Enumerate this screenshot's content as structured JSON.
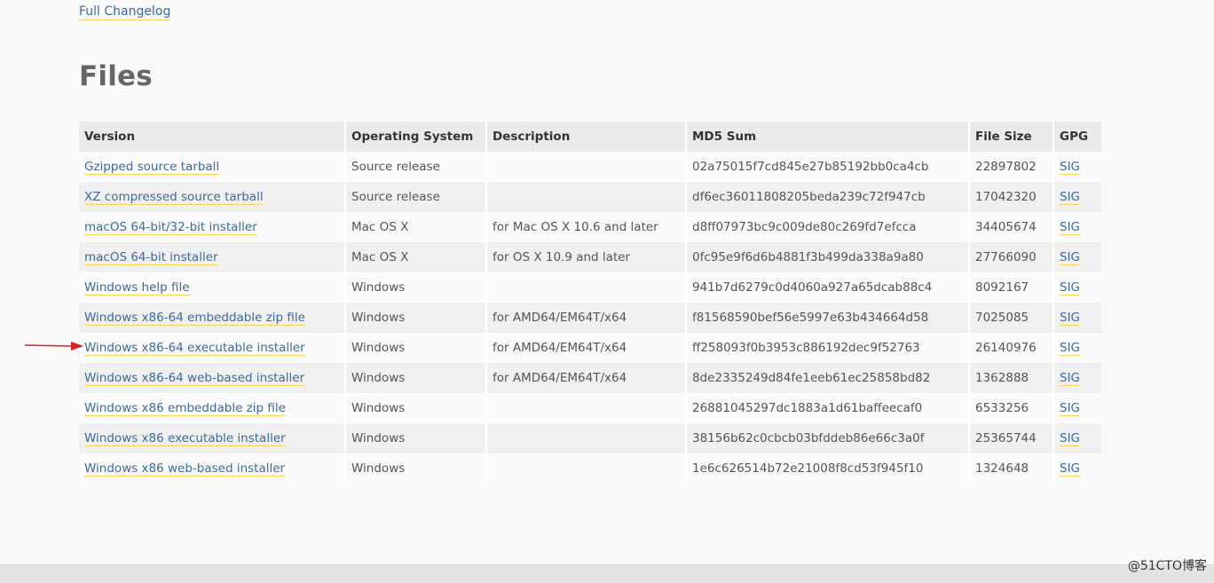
{
  "changelog": {
    "label": "Full Changelog"
  },
  "files": {
    "heading": "Files",
    "columns": [
      "Version",
      "Operating System",
      "Description",
      "MD5 Sum",
      "File Size",
      "GPG"
    ],
    "rows": [
      {
        "version": "Gzipped source tarball",
        "os": "Source release",
        "description": "",
        "md5": "02a75015f7cd845e27b85192bb0ca4cb",
        "size": "22897802",
        "gpg": "SIG"
      },
      {
        "version": "XZ compressed source tarball",
        "os": "Source release",
        "description": "",
        "md5": "df6ec36011808205beda239c72f947cb",
        "size": "17042320",
        "gpg": "SIG"
      },
      {
        "version": "macOS 64-bit/32-bit installer",
        "os": "Mac OS X",
        "description": "for Mac OS X 10.6 and later",
        "md5": "d8ff07973bc9c009de80c269fd7efcca",
        "size": "34405674",
        "gpg": "SIG"
      },
      {
        "version": "macOS 64-bit installer",
        "os": "Mac OS X",
        "description": "for OS X 10.9 and later",
        "md5": "0fc95e9f6d6b4881f3b499da338a9a80",
        "size": "27766090",
        "gpg": "SIG"
      },
      {
        "version": "Windows help file",
        "os": "Windows",
        "description": "",
        "md5": "941b7d6279c0d4060a927a65dcab88c4",
        "size": "8092167",
        "gpg": "SIG"
      },
      {
        "version": "Windows x86-64 embeddable zip file",
        "os": "Windows",
        "description": "for AMD64/EM64T/x64",
        "md5": "f81568590bef56e5997e63b434664d58",
        "size": "7025085",
        "gpg": "SIG"
      },
      {
        "version": "Windows x86-64 executable installer",
        "os": "Windows",
        "description": "for AMD64/EM64T/x64",
        "md5": "ff258093f0b3953c886192dec9f52763",
        "size": "26140976",
        "gpg": "SIG"
      },
      {
        "version": "Windows x86-64 web-based installer",
        "os": "Windows",
        "description": "for AMD64/EM64T/x64",
        "md5": "8de2335249d84fe1eeb61ec25858bd82",
        "size": "1362888",
        "gpg": "SIG"
      },
      {
        "version": "Windows x86 embeddable zip file",
        "os": "Windows",
        "description": "",
        "md5": "26881045297dc1883a1d61baffeecaf0",
        "size": "6533256",
        "gpg": "SIG"
      },
      {
        "version": "Windows x86 executable installer",
        "os": "Windows",
        "description": "",
        "md5": "38156b62c0cbcb03bfddeb86e66c3a0f",
        "size": "25365744",
        "gpg": "SIG"
      },
      {
        "version": "Windows x86 web-based installer",
        "os": "Windows",
        "description": "",
        "md5": "1e6c626514b72e21008f8cd53f945f10",
        "size": "1324648",
        "gpg": "SIG"
      }
    ]
  },
  "annotation": {
    "icon": "red-arrow-icon",
    "color": "#e02020"
  },
  "colors": {
    "link": "#3b6aa3",
    "link_underline": "#f5d55b",
    "header_bg": "#eaeaea"
  },
  "watermark": "@51CTO博客"
}
